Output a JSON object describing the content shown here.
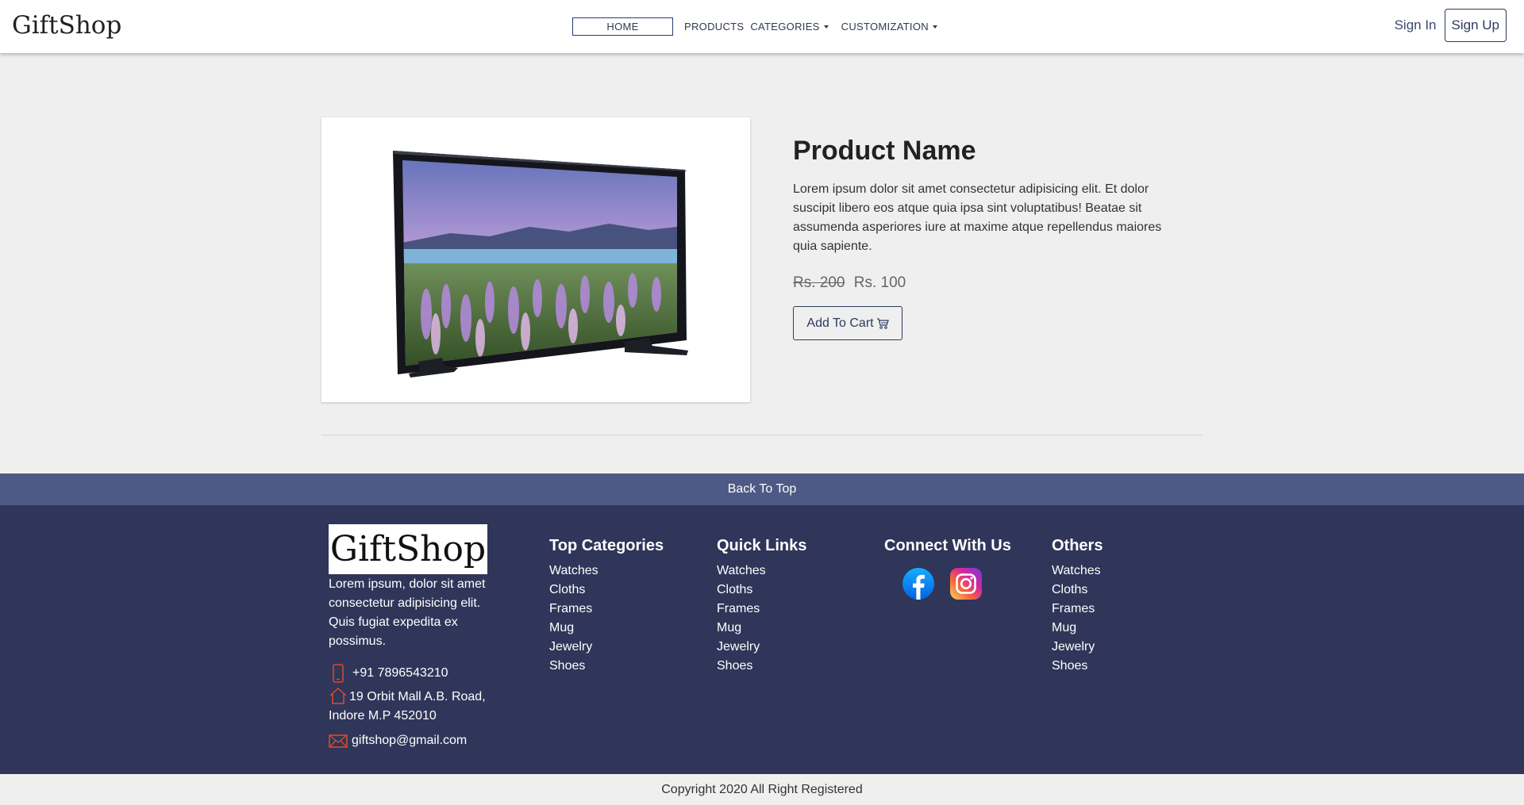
{
  "nav": {
    "logo": "GiftShop",
    "home": "HOME",
    "products": "PRODUCTS",
    "categories": "CATEGORIES",
    "customization": "CUSTOMIZATION",
    "sign_in": "Sign In",
    "sign_up": "Sign Up"
  },
  "product": {
    "name": "Product Name",
    "description": "Lorem ipsum dolor sit amet consectetur adipisicing elit. Et dolor suscipit libero eos atque quia ipsa sint voluptatibus! Beatae sit assumenda asperiores iure at maxime atque repellendus maiores quia sapiente.",
    "old_price": "Rs. 200",
    "price": "Rs. 100",
    "add_to_cart": "Add To Cart"
  },
  "footer": {
    "back_to_top": "Back To Top",
    "logo": "GiftShop",
    "about": "Lorem ipsum, dolor sit amet consectetur adipisicing elit. Quis fugiat expedita ex possimus.",
    "phone": "+91 7896543210",
    "address": "19 Orbit Mall A.B. Road, Indore M.P 452010",
    "email": "giftshop@gmail.com",
    "top_categories": {
      "title": "Top Categories",
      "items": [
        "Watches",
        "Cloths",
        "Frames",
        "Mug",
        "Jewelry",
        "Shoes"
      ]
    },
    "quick_links": {
      "title": "Quick Links",
      "items": [
        "Watches",
        "Cloths",
        "Frames",
        "Mug",
        "Jewelry",
        "Shoes"
      ]
    },
    "connect": {
      "title": "Connect With Us",
      "icons": [
        "facebook-icon",
        "instagram-icon"
      ]
    },
    "others": {
      "title": "Others",
      "items": [
        "Watches",
        "Cloths",
        "Frames",
        "Mug",
        "Jewelry",
        "Shoes"
      ]
    },
    "copyright": "Copyright 2020 All Right Registered"
  },
  "colors": {
    "accent": "#2d3a5e",
    "footer_bg": "#2f3659",
    "back_top_bg": "#4e5985",
    "contact_icon": "#e0482a"
  }
}
